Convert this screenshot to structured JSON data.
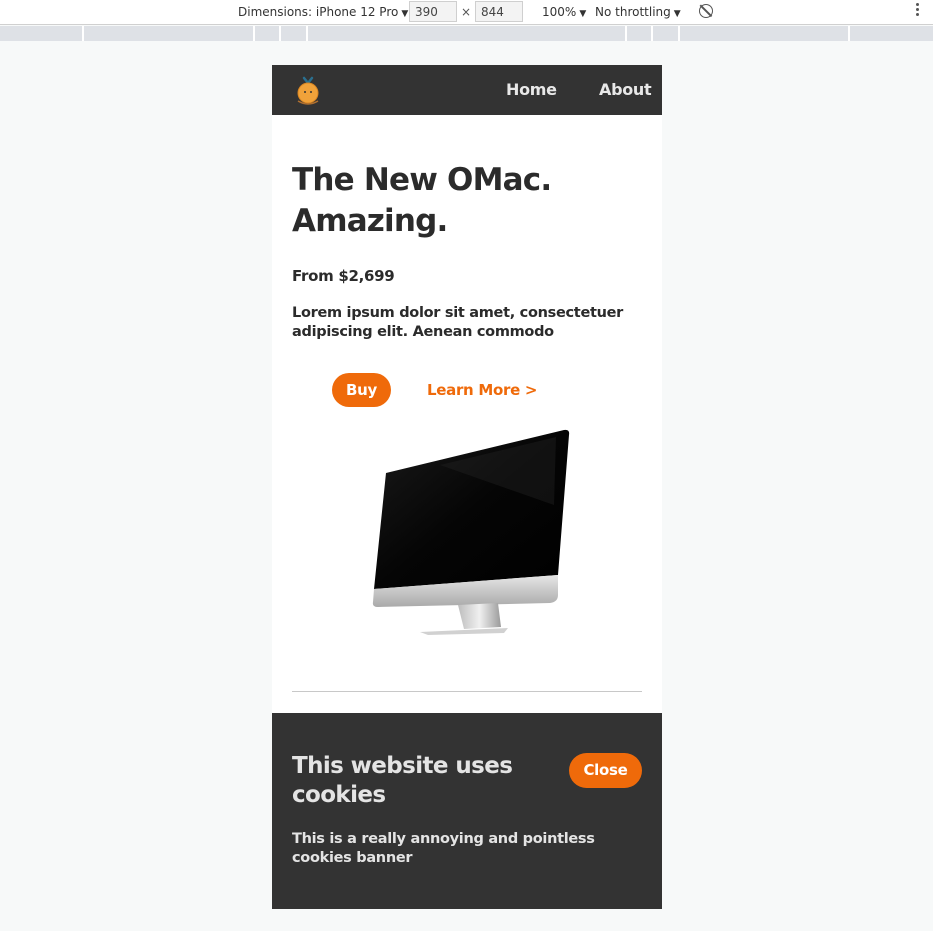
{
  "devtools": {
    "dimensions_label": "Dimensions: iPhone 12 Pro",
    "width": "390",
    "height": "844",
    "times": "×",
    "zoom": "100%",
    "throttling": "No throttling"
  },
  "site": {
    "nav": {
      "home": "Home",
      "about": "About"
    },
    "hero": {
      "title": "The New OMac. Amazing.",
      "price": "From $2,699",
      "description": "Lorem ipsum dolor sit amet, consectetuer adipiscing elit. Aenean commodo",
      "buy_label": "Buy",
      "learn_label": "Learn More >"
    },
    "cookie": {
      "title": "This website uses cookies",
      "text": "This is a really annoying and pointless cookies banner",
      "close_label": "Close"
    }
  },
  "colors": {
    "accent": "#ef6a0a",
    "dark": "#333333",
    "text": "#2b2b2b"
  }
}
